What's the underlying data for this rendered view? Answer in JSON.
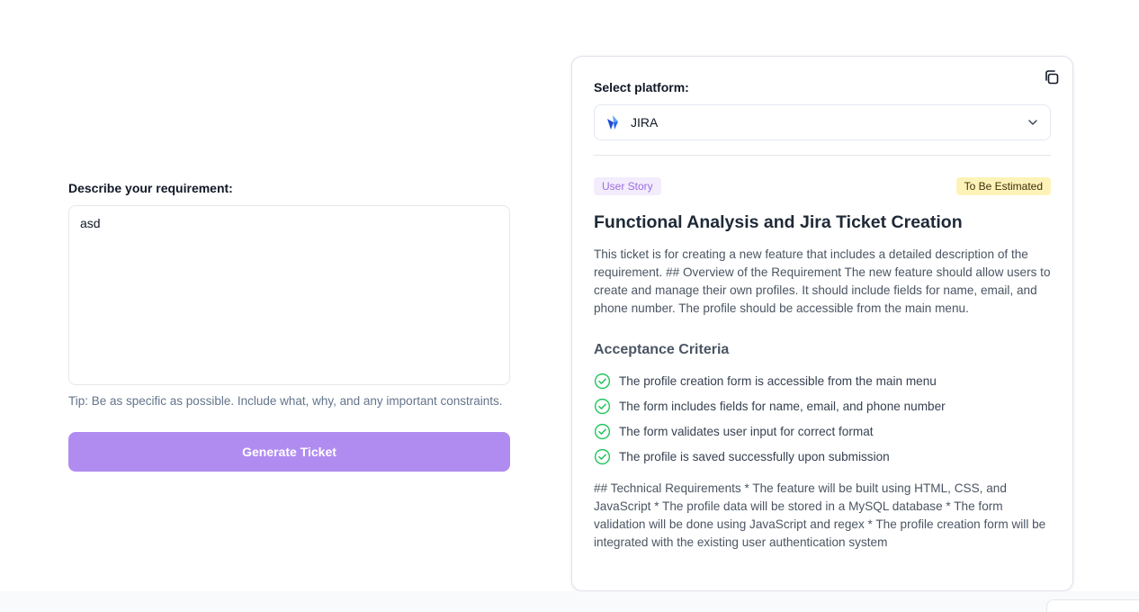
{
  "requirement": {
    "label": "Describe your requirement:",
    "value": "asd",
    "tip": "Tip: Be as specific as possible. Include what, why, and any important constraints.",
    "generate_label": "Generate Ticket"
  },
  "ticket": {
    "platform_label": "Select platform:",
    "platform_value": "JIRA",
    "type_badge": "User Story",
    "status_badge": "To Be Estimated",
    "title": "Functional Analysis and Jira Ticket Creation",
    "description": "This ticket is for creating a new feature that includes a detailed description of the requirement. ## Overview of the Requirement The new feature should allow users to create and manage their own profiles. It should include fields for name, email, and phone number. The profile should be accessible from the main menu.",
    "acceptance_heading": "Acceptance Criteria",
    "acceptance_criteria": [
      "The profile creation form is accessible from the main menu",
      "The form includes fields for name, email, and phone number",
      "The form validates user input for correct format",
      "The profile is saved successfully upon submission"
    ],
    "technical": "## Technical Requirements * The feature will be built using HTML, CSS, and JavaScript * The profile data will be stored in a MySQL database * The form validation will be done using JavaScript and regex * The profile creation form will be integrated with the existing user authentication system"
  },
  "icons": {
    "copy": "copy-icon",
    "platform": "jira-icon",
    "dropdown": "chevron-down-icon",
    "criteria": "check-circle-icon"
  },
  "colors": {
    "primary_button": "#b18cf0",
    "type_badge_bg": "#f3ecfd",
    "type_badge_text": "#9b6fdc",
    "status_badge_bg": "#fdf3b8",
    "check_green": "#22c55e",
    "jira_blue": "#2563eb"
  }
}
